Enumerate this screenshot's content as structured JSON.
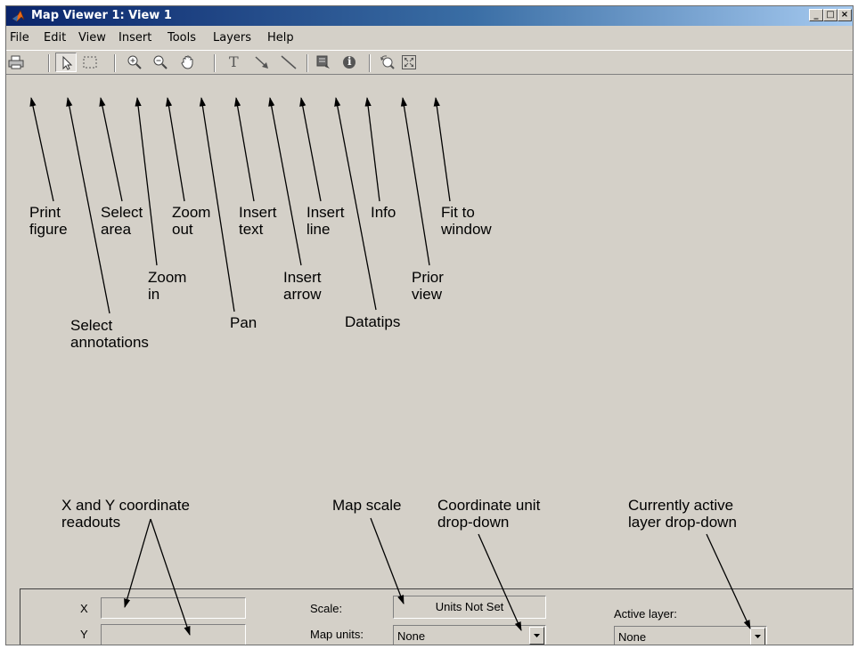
{
  "window": {
    "title": "Map Viewer 1: View 1",
    "controls": {
      "minimize": "_",
      "maximize": "□",
      "close": "×"
    }
  },
  "menu": [
    "File",
    "Edit",
    "View",
    "Insert",
    "Tools",
    "Layers",
    "Help"
  ],
  "toolbar": {
    "buttons": [
      {
        "id": "print",
        "icon": "printer-icon"
      },
      {
        "id": "select-annotations",
        "icon": "arrow-cursor-icon",
        "active": true
      },
      {
        "id": "select-area",
        "icon": "dashed-rectangle-icon"
      },
      {
        "id": "zoom-in",
        "icon": "zoom-in-icon"
      },
      {
        "id": "zoom-out",
        "icon": "zoom-out-icon"
      },
      {
        "id": "pan",
        "icon": "hand-icon"
      },
      {
        "id": "insert-text",
        "icon": "text-t-icon",
        "glyph": "T"
      },
      {
        "id": "insert-arrow",
        "icon": "arrow-icon"
      },
      {
        "id": "insert-line",
        "icon": "line-icon"
      },
      {
        "id": "datatips",
        "icon": "datatip-icon"
      },
      {
        "id": "info",
        "icon": "info-icon",
        "glyph": "i"
      },
      {
        "id": "prior-view",
        "icon": "prior-view-icon"
      },
      {
        "id": "fit-to-window",
        "icon": "fit-window-icon"
      }
    ]
  },
  "annotations": {
    "print_figure": [
      "Print",
      "figure"
    ],
    "select_annotations": [
      "Select",
      "annotations"
    ],
    "select_area": [
      "Select",
      "area"
    ],
    "zoom_in": [
      "Zoom",
      "in"
    ],
    "zoom_out": [
      "Zoom",
      "out"
    ],
    "pan": [
      "Pan"
    ],
    "insert_text": [
      "Insert",
      "text"
    ],
    "insert_arrow": [
      "Insert",
      "arrow"
    ],
    "insert_line": [
      "Insert",
      "line"
    ],
    "datatips": [
      "Datatips"
    ],
    "info": [
      "Info"
    ],
    "prior_view": [
      "Prior",
      "view"
    ],
    "fit_to_window": [
      "Fit to",
      "window"
    ],
    "coordinate_readouts": [
      "X and Y coordinate",
      "readouts"
    ],
    "map_scale": [
      "Map scale"
    ],
    "coordinate_unit": [
      "Coordinate unit",
      "drop-down"
    ],
    "active_layer": [
      "Currently active",
      "layer drop-down"
    ]
  },
  "status": {
    "x_label": "X",
    "y_label": "Y",
    "x_value": "",
    "y_value": "",
    "scale_label": "Scale:",
    "scale_value": "Units Not Set",
    "map_units_label": "Map units:",
    "map_units_value": "None",
    "active_layer_label": "Active layer:",
    "active_layer_value": "None"
  }
}
